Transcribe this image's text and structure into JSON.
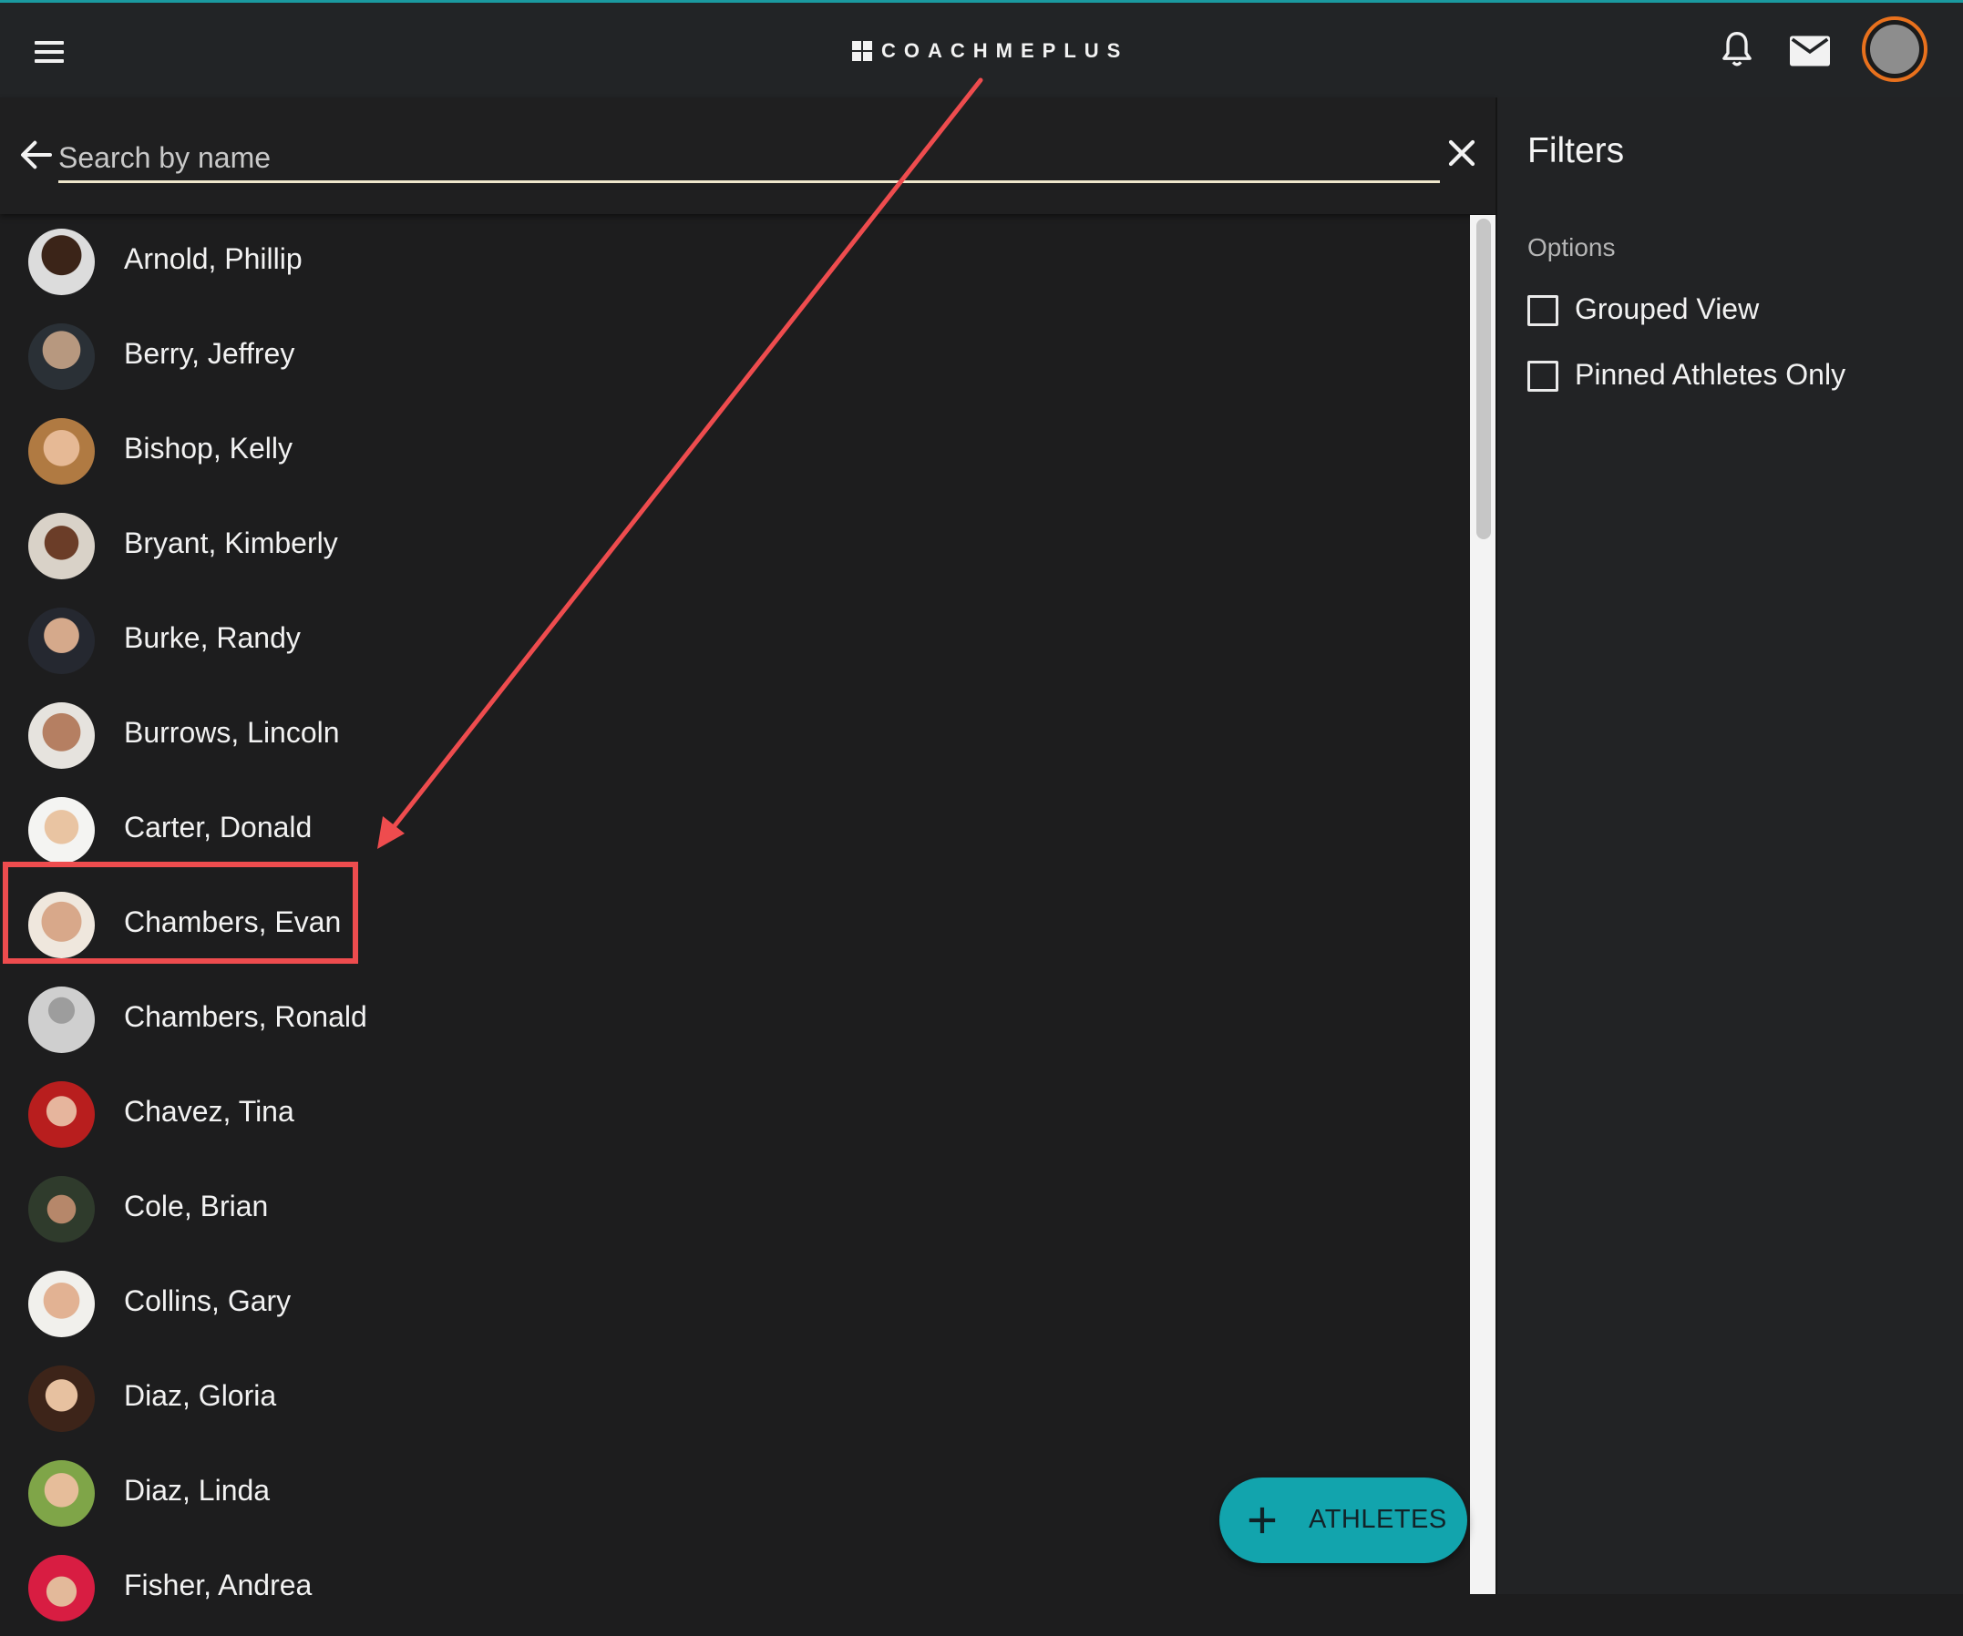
{
  "app": {
    "logo_text": "COACHMEPLUS"
  },
  "header": {
    "icons": [
      "menu-icon",
      "bell-icon",
      "mail-icon",
      "user-avatar"
    ]
  },
  "search": {
    "placeholder": "Search by name",
    "value": ""
  },
  "athletes": [
    {
      "name": "Arnold, Phillip"
    },
    {
      "name": "Berry, Jeffrey"
    },
    {
      "name": "Bishop, Kelly"
    },
    {
      "name": "Bryant, Kimberly"
    },
    {
      "name": "Burke, Randy"
    },
    {
      "name": "Burrows, Lincoln"
    },
    {
      "name": "Carter, Donald"
    },
    {
      "name": "Chambers, Evan"
    },
    {
      "name": "Chambers, Ronald"
    },
    {
      "name": "Chavez, Tina"
    },
    {
      "name": "Cole, Brian"
    },
    {
      "name": "Collins, Gary"
    },
    {
      "name": "Diaz, Gloria"
    },
    {
      "name": "Diaz, Linda"
    },
    {
      "name": "Fisher, Andrea"
    }
  ],
  "highlighted_athlete": "Chambers, Evan",
  "fab": {
    "label": "ATHLETES"
  },
  "filters": {
    "title": "Filters",
    "section_label": "Options",
    "options": [
      {
        "label": "Grouped View",
        "checked": false
      },
      {
        "label": "Pinned Athletes Only",
        "checked": false
      }
    ]
  },
  "colors": {
    "accent_teal": "#12a4ad",
    "avatar_ring": "#e8711d",
    "annotation_red": "#ee4c4e",
    "background": "#1d1d1e"
  }
}
